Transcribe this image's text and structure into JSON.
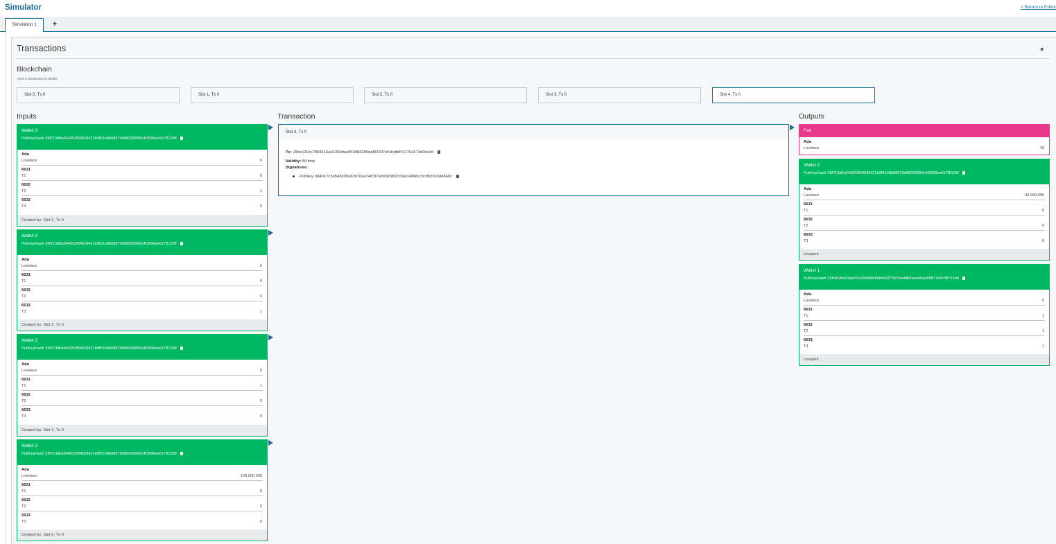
{
  "app": {
    "title": "Simulator",
    "return_link": "< Return to Editor"
  },
  "tabs": [
    {
      "label": "Simulation 1"
    }
  ],
  "tab_add_label": "+",
  "panel": {
    "title": "Transactions",
    "close_label": "×"
  },
  "blockchain": {
    "title": "Blockchain",
    "hint": "Click a transaction for details",
    "transactions": [
      "Slot 0, Tx 0",
      "Slot 1, Tx 0",
      "Slot 2, Tx 0",
      "Slot 3, Tx 0",
      "Slot 4, Tx 0"
    ],
    "active_index": 4
  },
  "columns": {
    "inputs": "Inputs",
    "transaction": "Transaction",
    "outputs": "Outputs"
  },
  "labels": {
    "ada": "Ada",
    "lovelace": "Lovelace",
    "token_policy_1": "6631",
    "token_policy_2": "6632",
    "token_policy_3": "6633",
    "t1": "T1",
    "t2": "T2",
    "t3": "T3"
  },
  "inputs": [
    {
      "wallet": "Wallet 2",
      "pubkey": "PubKeyHash 39f713d0a644253f04529421b9f51b9b08979d08295959c4f3990ee617f5139f",
      "lovelace": "0",
      "t1": "0",
      "t2": "1",
      "t3": "0",
      "footer": "Created by: Slot 2, Tx 0"
    },
    {
      "wallet": "Wallet 2",
      "pubkey": "PubKeyHash 39f713d0a644253f04529421b9f51b9b08979d08295959c4f3990ee617f5139f",
      "lovelace": "0",
      "t1": "0",
      "t2": "0",
      "t3": "1",
      "footer": "Created by: Slot 3, Tx 0"
    },
    {
      "wallet": "Wallet 2",
      "pubkey": "PubKeyHash 39f713d0a644253f04529421b9f51b9b08979d08295959c4f3990ee617f5139f",
      "lovelace": "0",
      "t1": "1",
      "t2": "0",
      "t3": "0",
      "footer": "Created by: Slot 1, Tx 0"
    },
    {
      "wallet": "Wallet 2",
      "pubkey": "PubKeyHash 39f713d0a644253f04529421b9f51b9b08979d08295959c4f3990ee617f5139f",
      "lovelace": "100,000,000",
      "t1": "0",
      "t2": "0",
      "t3": "0",
      "footer": "Created by: Slot 0, Tx 0"
    }
  ],
  "transaction": {
    "slot": "Slot 4, Tx 0",
    "tx_label": "Tx:",
    "tx_id": "15be130cc7804416a01390dac8930b3286daf03207e5dcdb6011764373d0ce1d",
    "validity_label": "Validity:",
    "validity": "All time",
    "signatures_label": "Signatures:",
    "signature": "PubKey 3d4017c3e843895a92b70aa74d1b7ebc9c982ccf2ec4968cc0cd55f12af4660c"
  },
  "fee": {
    "title": "Fee",
    "lovelace": "10"
  },
  "outputs": [
    {
      "wallet": "Wallet 2",
      "pubkey": "PubKeyHash 39f713d0a644253f04529421b9f51b9b08979d08295959c4f3990ee617f5139f",
      "lovelace": "99,999,990",
      "t1": "0",
      "t2": "0",
      "t3": "0",
      "footer": "Unspent"
    },
    {
      "wallet": "Wallet 1",
      "pubkey": "PubKeyHash 21fe31dfa154a261626bf854046fd2271b7bed4b6abe45aa58877ef47f9721b9",
      "lovelace": "0",
      "t1": "1",
      "t2": "1",
      "t3": "1",
      "footer": "Unspent"
    }
  ],
  "colors": {
    "accent": "#1b6b9a",
    "wallet_green": "#00b862",
    "fee_pink": "#e8388c"
  },
  "icons": {
    "copy": "clipboard-icon",
    "arrow": "play-arrow-icon",
    "close": "close-icon",
    "add": "plus-icon"
  }
}
